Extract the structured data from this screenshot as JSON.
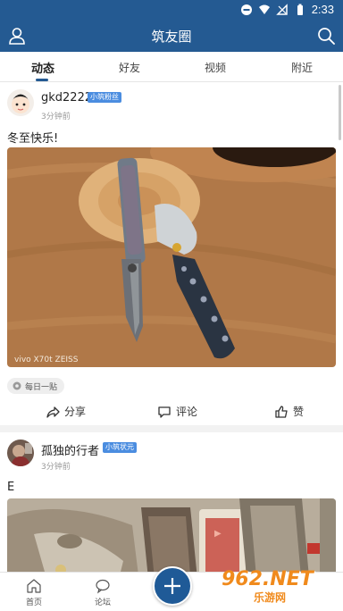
{
  "status_bar": {
    "time": "2:33"
  },
  "app_bar": {
    "title": "筑友圈"
  },
  "tabs": [
    {
      "label": "动态",
      "active": true
    },
    {
      "label": "好友",
      "active": false
    },
    {
      "label": "视频",
      "active": false
    },
    {
      "label": "附近",
      "active": false
    }
  ],
  "posts": [
    {
      "username": "gkd2222",
      "badge": "小筑粉丝",
      "time": "3分钟前",
      "text": "冬至快乐!",
      "image_caption": "vivo X70t   ZEISS",
      "tag": "每日一贴",
      "actions": {
        "share": "分享",
        "comment": "评论",
        "like": "赞"
      }
    },
    {
      "username": "孤独的行者",
      "badge": "小筑状元",
      "time": "3分钟前",
      "text": "E"
    }
  ],
  "bottom_nav": [
    {
      "label": "首页",
      "icon": "home-icon"
    },
    {
      "label": "论坛",
      "icon": "chat-icon"
    },
    {
      "label": "发布",
      "icon": "plus-icon"
    }
  ],
  "watermark": {
    "logo": "962.NET",
    "sub": "乐游网"
  },
  "colors": {
    "primary": "#245a92",
    "badge": "#4b8de0",
    "fab": "#1f5a97",
    "watermark": "#f08a1c"
  }
}
